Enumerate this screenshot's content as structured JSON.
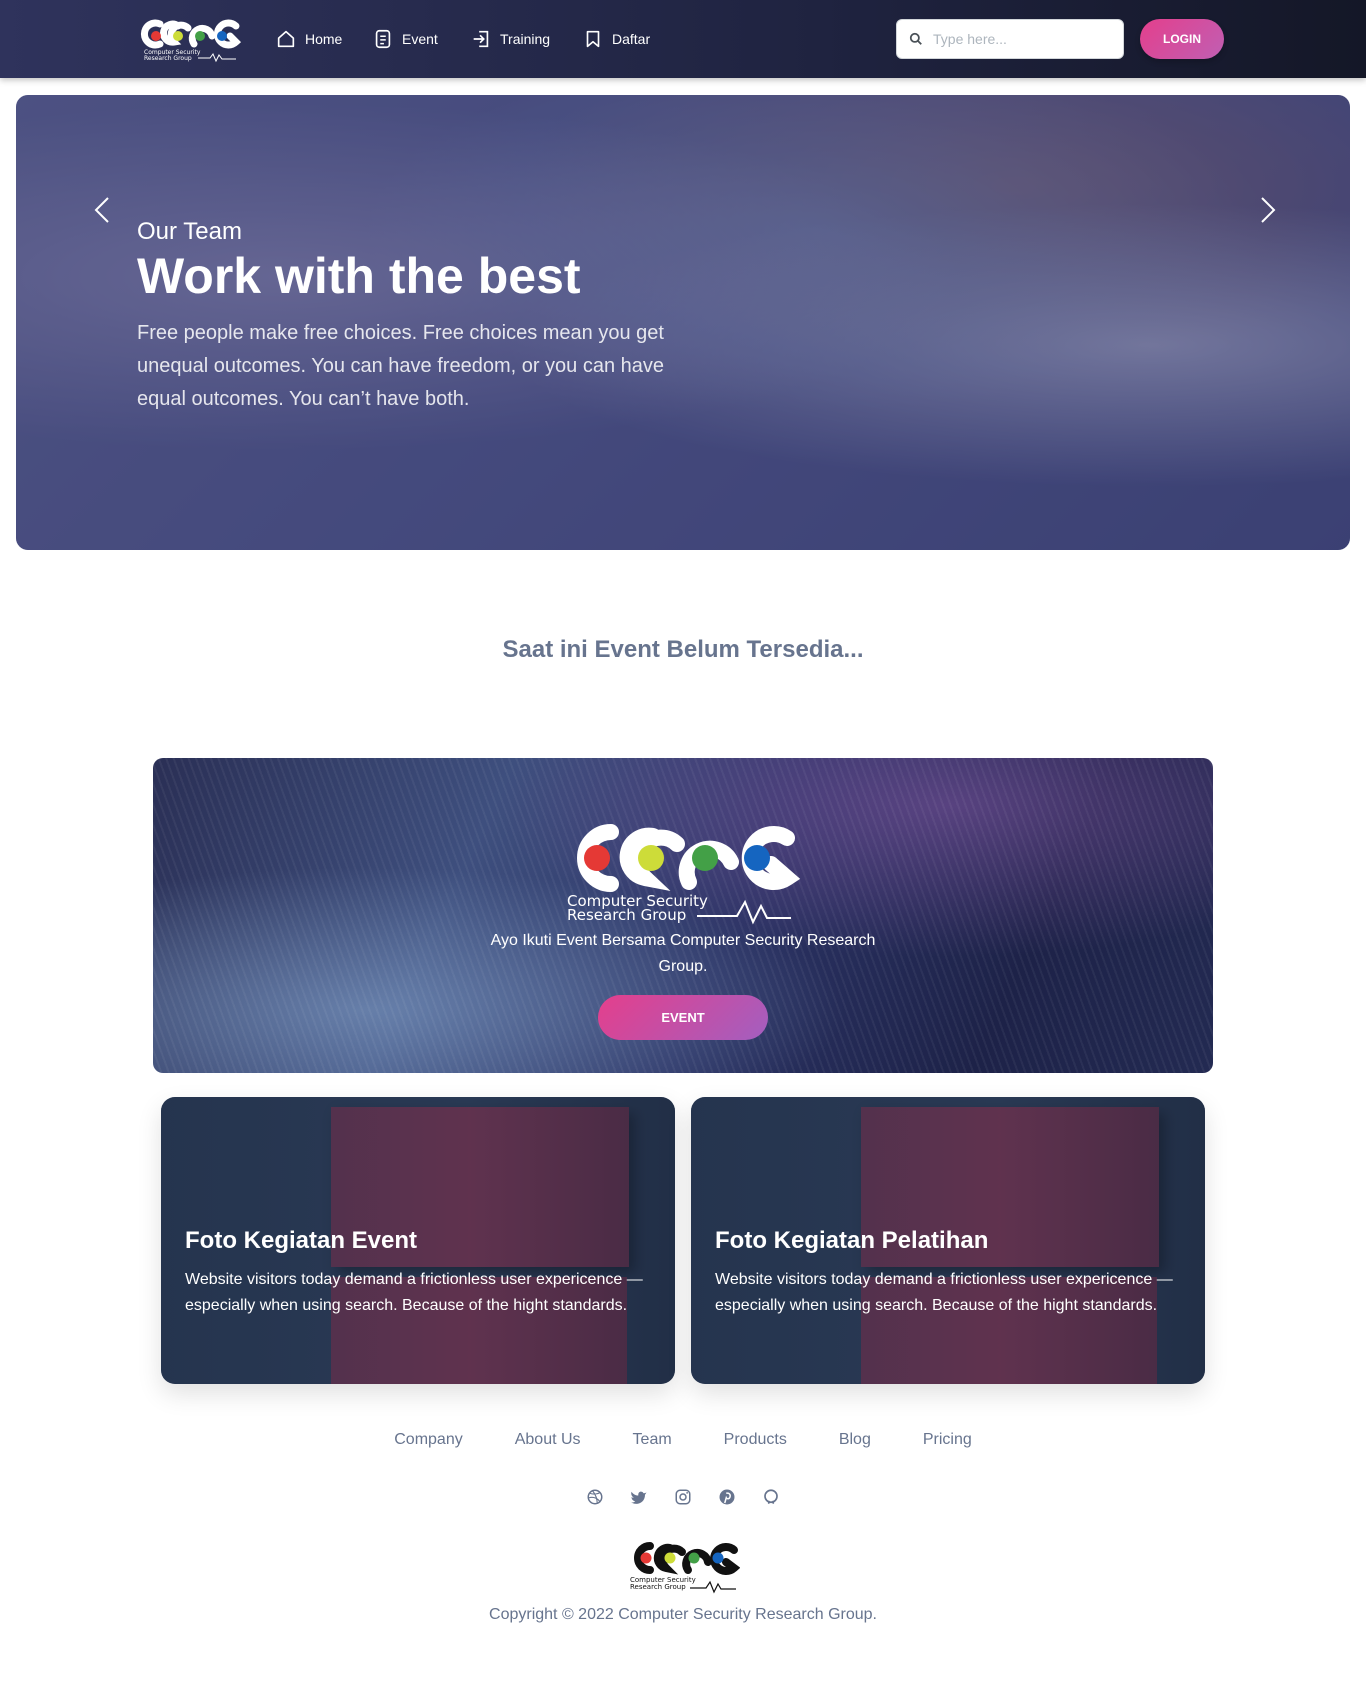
{
  "navbar": {
    "logo_alt": "CSRG",
    "items": [
      {
        "label": "Home",
        "icon": "home-icon"
      },
      {
        "label": "Event",
        "icon": "document-icon"
      },
      {
        "label": "Training",
        "icon": "login-arrow-icon"
      },
      {
        "label": "Daftar",
        "icon": "bookmark-icon"
      }
    ],
    "search_placeholder": "Type here...",
    "login_label": "LOGIN"
  },
  "hero": {
    "subtitle": "Our Team",
    "title": "Work with the best",
    "text": "Free people make free choices. Free choices mean you get unequal outcomes. You can have freedom, or you can have equal outcomes. You can’t have both."
  },
  "empty_message": "Saat ini Event Belum Tersedia...",
  "cta": {
    "logo_line1": "Computer Security",
    "logo_line2": "Research Group",
    "text": "Ayo Ikuti Event Bersama Computer Security Research Group.",
    "button_label": "EVENT"
  },
  "cards": [
    {
      "title": "Foto Kegiatan Event",
      "text": "Website visitors today demand a frictionless user expericence — especially when using search. Because of the hight standards."
    },
    {
      "title": "Foto Kegiatan Pelatihan",
      "text": "Website visitors today demand a frictionless user expericence — especially when using search. Because of the hight standards."
    }
  ],
  "footer": {
    "links": [
      "Company",
      "About Us",
      "Team",
      "Products",
      "Blog",
      "Pricing"
    ],
    "social": [
      "dribbble-icon",
      "twitter-icon",
      "instagram-icon",
      "pinterest-icon",
      "github-icon"
    ],
    "copyright": "Copyright © 2022 Computer Security Research Group."
  },
  "colors": {
    "accent_pink": "#e43f8c",
    "accent_purple": "#a35fc0",
    "navbar_dark": "#1f2340",
    "muted_text": "#67748e"
  }
}
